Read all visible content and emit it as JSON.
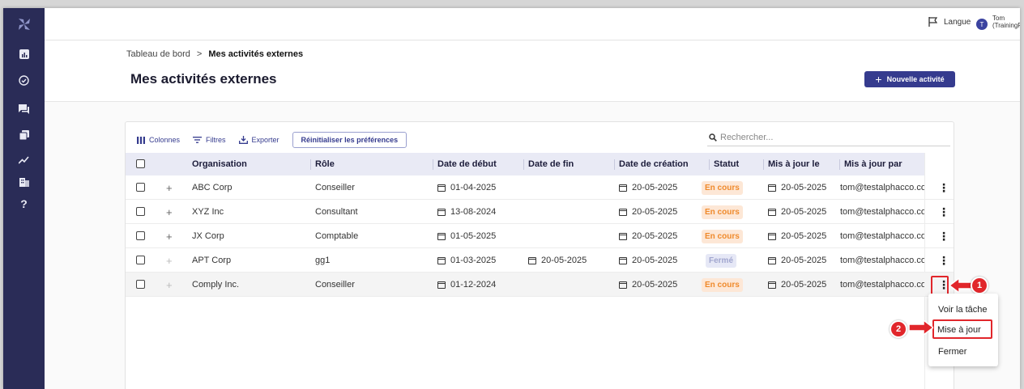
{
  "topbar": {
    "language_label": "Langue",
    "avatar_initial": "T",
    "user_name": "Tom",
    "user_org": "(TrainingFrench)"
  },
  "breadcrumb": {
    "home": "Tableau de bord",
    "separator": ">",
    "current": "Mes activités externes"
  },
  "page": {
    "title": "Mes activités externes",
    "new_button": "Nouvelle activité",
    "new_button_icon": "+"
  },
  "toolbar": {
    "columns": "Colonnes",
    "filters": "Filtres",
    "export": "Exporter",
    "reset": "Réinitialiser les préférences"
  },
  "search": {
    "placeholder": "Rechercher..."
  },
  "table": {
    "headers": [
      "Organisation",
      "Rôle",
      "Date de début",
      "Date de fin",
      "Date de création",
      "Statut",
      "Mis à jour le",
      "Mis à jour par"
    ],
    "rows": [
      {
        "org": "ABC Corp",
        "role": "Conseiller",
        "start": "01-04-2025",
        "end": "",
        "created": "20-05-2025",
        "status": "En cours",
        "updated": "20-05-2025",
        "by": "tom@testalphacco.co"
      },
      {
        "org": "XYZ Inc",
        "role": "Consultant",
        "start": "13-08-2024",
        "end": "",
        "created": "20-05-2025",
        "status": "En cours",
        "updated": "20-05-2025",
        "by": "tom@testalphacco.co"
      },
      {
        "org": "JX Corp",
        "role": "Comptable",
        "start": "01-05-2025",
        "end": "",
        "created": "20-05-2025",
        "status": "En cours",
        "updated": "20-05-2025",
        "by": "tom@testalphacco.co"
      },
      {
        "org": "APT Corp",
        "role": "gg1",
        "start": "01-03-2025",
        "end": "20-05-2025",
        "created": "20-05-2025",
        "status": "Fermé",
        "updated": "20-05-2025",
        "by": "tom@testalphacco.co"
      },
      {
        "org": "Comply Inc.",
        "role": "Conseiller",
        "start": "01-12-2024",
        "end": "",
        "created": "20-05-2025",
        "status": "En cours",
        "updated": "20-05-2025",
        "by": "tom@testalphacco.co"
      }
    ]
  },
  "row_menu": {
    "items": [
      "Voir la tâche",
      "Mise à jour",
      "Fermer"
    ]
  },
  "annotations": {
    "step1": "1",
    "step2": "2"
  },
  "sidebar": {
    "help": "?"
  },
  "colors": {
    "sidebar_bg": "#2a2c57",
    "accent": "#353b8e",
    "status_open": "#ef8a2c",
    "status_closed": "#a1a6cf",
    "annotation_red": "#e1262b"
  },
  "icons": [
    "app-logo-icon",
    "dashboard-icon",
    "check-circle-icon",
    "chat-icon",
    "cards-icon",
    "trend-icon",
    "building-icon",
    "help-icon",
    "flag-icon",
    "columns-icon",
    "filter-icon",
    "export-icon",
    "search-icon",
    "calendar-icon",
    "kebab-icon"
  ]
}
